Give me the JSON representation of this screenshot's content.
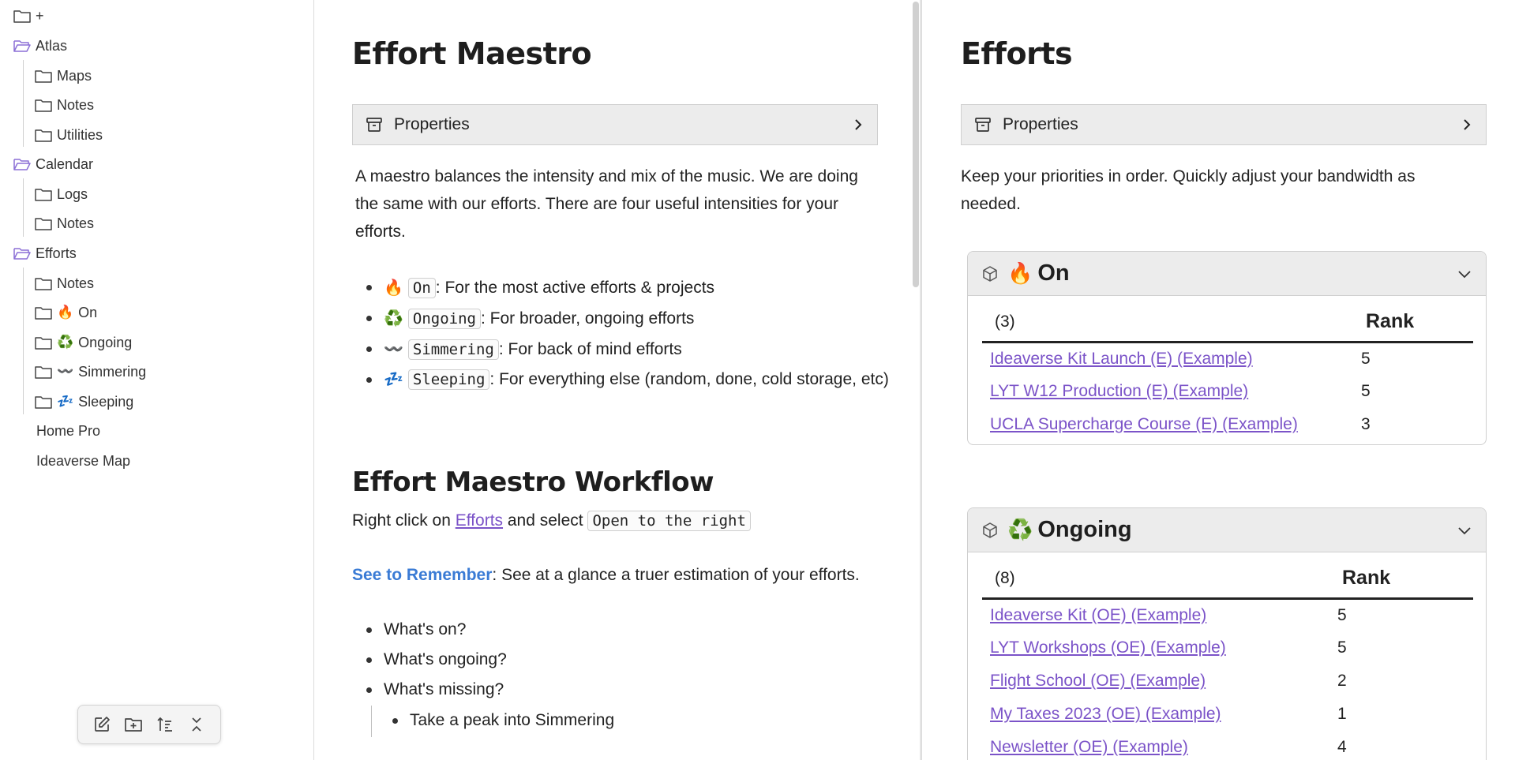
{
  "sidebar": {
    "items": [
      {
        "label": "+",
        "type": "folder"
      },
      {
        "label": "Atlas",
        "type": "folder-open"
      },
      {
        "label": "Maps",
        "type": "folder"
      },
      {
        "label": "Notes",
        "type": "folder"
      },
      {
        "label": "Utilities",
        "type": "folder"
      },
      {
        "label": "Calendar",
        "type": "folder-open"
      },
      {
        "label": "Logs",
        "type": "folder"
      },
      {
        "label": "Notes",
        "type": "folder"
      },
      {
        "label": "Efforts",
        "type": "folder-open"
      },
      {
        "label": "Notes",
        "type": "folder"
      },
      {
        "label": "On",
        "emoji": "🔥",
        "type": "folder"
      },
      {
        "label": "Ongoing",
        "emoji": "♻️",
        "type": "folder"
      },
      {
        "label": "Simmering",
        "emoji": "〰️",
        "type": "folder"
      },
      {
        "label": "Sleeping",
        "emoji": "💤",
        "type": "folder"
      },
      {
        "label": "Home Pro",
        "type": "file"
      },
      {
        "label": "Ideaverse Map",
        "type": "file"
      }
    ],
    "toolbar": [
      "new-note-icon",
      "new-folder-icon",
      "sort-icon",
      "collapse-icon"
    ]
  },
  "left": {
    "title": "Effort Maestro",
    "properties_label": "Properties",
    "intro": "A maestro balances the intensity and mix of the music. We are doing the same with our efforts. There are four useful intensities for your efforts.",
    "intensities": [
      {
        "emoji": "🔥",
        "code": "On",
        "text": ": For the most active efforts & projects"
      },
      {
        "emoji": "♻️",
        "code": "Ongoing",
        "text": ": For broader, ongoing efforts"
      },
      {
        "emoji": "〰️",
        "code": "Simmering",
        "text": ": For back of mind efforts"
      },
      {
        "emoji": "💤",
        "code": "Sleeping",
        "text": ": For everything else (random, done, cold storage, etc)"
      }
    ],
    "workflow_title": "Effort Maestro Workflow",
    "workflow_prefix": "Right click on ",
    "workflow_link": "Efforts",
    "workflow_middle": " and select ",
    "workflow_code": "Open to the right",
    "see_link": "See to Remember",
    "see_text": ": See at a glance a truer estimation of your efforts.",
    "questions": [
      "What's on?",
      "What's ongoing?",
      "What's missing?"
    ],
    "nested": "Take a peak into Simmering"
  },
  "right": {
    "title": "Efforts",
    "properties_label": "Properties",
    "intro": "Keep your priorities in order. Quickly adjust your bandwidth as needed.",
    "on": {
      "emoji": "🔥",
      "label": "On",
      "count": "(3)",
      "rank_header": "Rank",
      "rows": [
        {
          "name": "Ideaverse Kit Launch (E) (Example)",
          "rank": "5"
        },
        {
          "name": "LYT W12 Production (E) (Example)",
          "rank": "5"
        },
        {
          "name": "UCLA Supercharge Course (E) (Example)",
          "rank": "3"
        }
      ]
    },
    "ongoing": {
      "emoji": "♻️",
      "label": "Ongoing",
      "count": "(8)",
      "rank_header": "Rank",
      "rows": [
        {
          "name": "Ideaverse Kit (OE) (Example)",
          "rank": "5"
        },
        {
          "name": "LYT Workshops (OE) (Example)",
          "rank": "5"
        },
        {
          "name": "Flight School (OE) (Example)",
          "rank": "2"
        },
        {
          "name": "My Taxes 2023 (OE) (Example)",
          "rank": "1"
        },
        {
          "name": "Newsletter (OE) (Example)",
          "rank": "4"
        }
      ]
    }
  },
  "colors": {
    "accent_link": "#7b53c8",
    "bold_link": "#3a7bd5",
    "folder_open": "#8b6fd6",
    "header_bg": "#ececec"
  }
}
